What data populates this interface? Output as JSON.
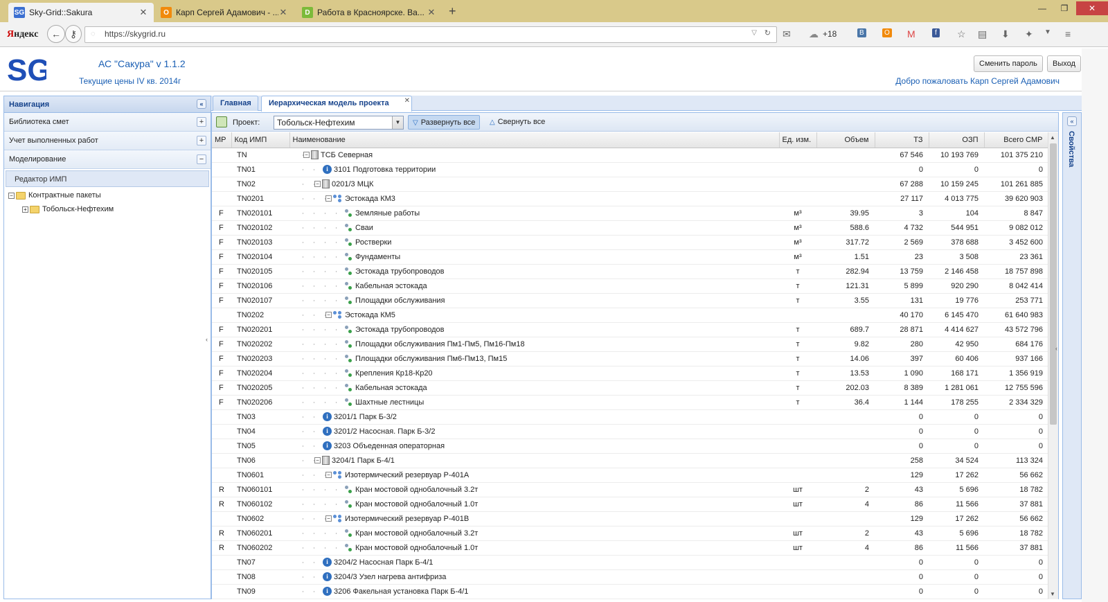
{
  "browser": {
    "tabs": [
      {
        "title": "Sky-Grid::Sakura",
        "favicon": "SG",
        "color": "#3b6fd1"
      },
      {
        "title": "Карп Сергей Адамович - ...",
        "favicon": "O",
        "color": "#f18a0c"
      },
      {
        "title": "Работа в Красноярске. Ва...",
        "favicon": "D",
        "color": "#7cba3a"
      }
    ],
    "logo_left": "Я",
    "logo_right": "ндекс",
    "url": "https://skygrid.ru",
    "weather": "+18"
  },
  "app": {
    "logo": "SG",
    "title": "АС \"Сакура\" v 1.1.2",
    "prices": "Текущие цены IV кв. 2014г",
    "change_password": "Сменить пароль",
    "logout": "Выход",
    "welcome": "Добро пожаловать Карп Сергей Адамович"
  },
  "nav": {
    "title": "Навигация",
    "items": [
      {
        "label": "Библиотека смет",
        "sign": "+"
      },
      {
        "label": "Учет выполненных работ",
        "sign": "+"
      },
      {
        "label": "Моделирование",
        "sign": "−"
      }
    ],
    "editor": "Редактор ИМП",
    "tree": {
      "root": "Контрактные пакеты",
      "child": "Тобольск-Нефтехим"
    }
  },
  "tabs": [
    {
      "label": "Главная"
    },
    {
      "label": "Иерархическая модель проекта"
    }
  ],
  "toolbar": {
    "project_label": "Проект:",
    "project": "Тобольск-Нефтехим",
    "expand": "Развернуть все",
    "collapse": "Свернуть все"
  },
  "properties": "Свойства",
  "grid": {
    "columns": [
      "МР",
      "Код ИМП",
      "Наименование",
      "Ед. изм.",
      "Объем",
      "ТЗ",
      "ОЗП",
      "Всего СМР"
    ],
    "rows": [
      {
        "mr": "",
        "code": "TN",
        "level": 0,
        "icon": "bldg",
        "toggle": "−",
        "name": "ТСБ Северная",
        "unit": "",
        "vol": "",
        "tz": "67 546",
        "ozp": "10 193 769",
        "smr": "101 375 210"
      },
      {
        "mr": "",
        "code": "TN01",
        "level": 1,
        "icon": "info",
        "toggle": "",
        "name": "3101 Подготовка территории",
        "unit": "",
        "vol": "",
        "tz": "0",
        "ozp": "0",
        "smr": "0"
      },
      {
        "mr": "",
        "code": "TN02",
        "level": 1,
        "icon": "bldg",
        "toggle": "−",
        "name": "0201/3 МЦК",
        "unit": "",
        "vol": "",
        "tz": "67 288",
        "ozp": "10 159 245",
        "smr": "101 261 885"
      },
      {
        "mr": "",
        "code": "TN0201",
        "level": 2,
        "icon": "tree3",
        "toggle": "−",
        "name": "Эстокада КМ3",
        "unit": "",
        "vol": "",
        "tz": "27 117",
        "ozp": "4 013 775",
        "smr": "39 620 903"
      },
      {
        "mr": "F",
        "code": "TN020101",
        "level": 3,
        "icon": "leaf",
        "toggle": "",
        "name": "Земляные работы",
        "unit": "м³",
        "vol": "39.95",
        "tz": "3",
        "ozp": "104",
        "smr": "8 847"
      },
      {
        "mr": "F",
        "code": "TN020102",
        "level": 3,
        "icon": "leaf",
        "toggle": "",
        "name": "Сваи",
        "unit": "м³",
        "vol": "588.6",
        "tz": "4 732",
        "ozp": "544 951",
        "smr": "9 082 012"
      },
      {
        "mr": "F",
        "code": "TN020103",
        "level": 3,
        "icon": "leaf",
        "toggle": "",
        "name": "Ростверки",
        "unit": "м³",
        "vol": "317.72",
        "tz": "2 569",
        "ozp": "378 688",
        "smr": "3 452 600"
      },
      {
        "mr": "F",
        "code": "TN020104",
        "level": 3,
        "icon": "leaf",
        "toggle": "",
        "name": "Фундаменты",
        "unit": "м³",
        "vol": "1.51",
        "tz": "23",
        "ozp": "3 508",
        "smr": "23 361"
      },
      {
        "mr": "F",
        "code": "TN020105",
        "level": 3,
        "icon": "leaf",
        "toggle": "",
        "name": "Эстокада трубопроводов",
        "unit": "т",
        "vol": "282.94",
        "tz": "13 759",
        "ozp": "2 146 458",
        "smr": "18 757 898"
      },
      {
        "mr": "F",
        "code": "TN020106",
        "level": 3,
        "icon": "leaf",
        "toggle": "",
        "name": "Кабельная эстокада",
        "unit": "т",
        "vol": "121.31",
        "tz": "5 899",
        "ozp": "920 290",
        "smr": "8 042 414"
      },
      {
        "mr": "F",
        "code": "TN020107",
        "level": 3,
        "icon": "leaf",
        "toggle": "",
        "name": "Площадки обслуживания",
        "unit": "т",
        "vol": "3.55",
        "tz": "131",
        "ozp": "19 776",
        "smr": "253 771"
      },
      {
        "mr": "",
        "code": "TN0202",
        "level": 2,
        "icon": "tree3",
        "toggle": "−",
        "name": "Эстокада КМ5",
        "unit": "",
        "vol": "",
        "tz": "40 170",
        "ozp": "6 145 470",
        "smr": "61 640 983"
      },
      {
        "mr": "F",
        "code": "TN020201",
        "level": 3,
        "icon": "leaf",
        "toggle": "",
        "name": "Эстокада трубопроводов",
        "unit": "т",
        "vol": "689.7",
        "tz": "28 871",
        "ozp": "4 414 627",
        "smr": "43 572 796"
      },
      {
        "mr": "F",
        "code": "TN020202",
        "level": 3,
        "icon": "leaf",
        "toggle": "",
        "name": "Площадки обслуживания Пм1-Пм5, Пм16-Пм18",
        "unit": "т",
        "vol": "9.82",
        "tz": "280",
        "ozp": "42 950",
        "smr": "684 176"
      },
      {
        "mr": "F",
        "code": "TN020203",
        "level": 3,
        "icon": "leaf",
        "toggle": "",
        "name": "Площадки обслуживания Пм6-Пм13, Пм15",
        "unit": "т",
        "vol": "14.06",
        "tz": "397",
        "ozp": "60 406",
        "smr": "937 166"
      },
      {
        "mr": "F",
        "code": "TN020204",
        "level": 3,
        "icon": "leaf",
        "toggle": "",
        "name": "Крепления Кр18-Кр20",
        "unit": "т",
        "vol": "13.53",
        "tz": "1 090",
        "ozp": "168 171",
        "smr": "1 356 919"
      },
      {
        "mr": "F",
        "code": "TN020205",
        "level": 3,
        "icon": "leaf",
        "toggle": "",
        "name": "Кабельная эстокада",
        "unit": "т",
        "vol": "202.03",
        "tz": "8 389",
        "ozp": "1 281 061",
        "smr": "12 755 596"
      },
      {
        "mr": "F",
        "code": "TN020206",
        "level": 3,
        "icon": "leaf",
        "toggle": "",
        "name": "Шахтные лестницы",
        "unit": "т",
        "vol": "36.4",
        "tz": "1 144",
        "ozp": "178 255",
        "smr": "2 334 329"
      },
      {
        "mr": "",
        "code": "TN03",
        "level": 1,
        "icon": "info",
        "toggle": "",
        "name": "3201/1 Парк Б-3/2",
        "unit": "",
        "vol": "",
        "tz": "0",
        "ozp": "0",
        "smr": "0"
      },
      {
        "mr": "",
        "code": "TN04",
        "level": 1,
        "icon": "info",
        "toggle": "",
        "name": "3201/2 Насосная. Парк Б-3/2",
        "unit": "",
        "vol": "",
        "tz": "0",
        "ozp": "0",
        "smr": "0"
      },
      {
        "mr": "",
        "code": "TN05",
        "level": 1,
        "icon": "info",
        "toggle": "",
        "name": "3203 Объеденная операторная",
        "unit": "",
        "vol": "",
        "tz": "0",
        "ozp": "0",
        "smr": "0"
      },
      {
        "mr": "",
        "code": "TN06",
        "level": 1,
        "icon": "bldg",
        "toggle": "−",
        "name": "3204/1 Парк Б-4/1",
        "unit": "",
        "vol": "",
        "tz": "258",
        "ozp": "34 524",
        "smr": "113 324"
      },
      {
        "mr": "",
        "code": "TN0601",
        "level": 2,
        "icon": "tree3",
        "toggle": "−",
        "name": "Изотермический резервуар Р-401А",
        "unit": "",
        "vol": "",
        "tz": "129",
        "ozp": "17 262",
        "smr": "56 662"
      },
      {
        "mr": "R",
        "code": "TN060101",
        "level": 3,
        "icon": "leaf",
        "toggle": "",
        "name": "Кран мостовой однобалочный 3.2т",
        "unit": "шт",
        "vol": "2",
        "tz": "43",
        "ozp": "5 696",
        "smr": "18 782"
      },
      {
        "mr": "R",
        "code": "TN060102",
        "level": 3,
        "icon": "leaf",
        "toggle": "",
        "name": "Кран мостовой однобалочный 1.0т",
        "unit": "шт",
        "vol": "4",
        "tz": "86",
        "ozp": "11 566",
        "smr": "37 881"
      },
      {
        "mr": "",
        "code": "TN0602",
        "level": 2,
        "icon": "tree3",
        "toggle": "−",
        "name": "Изотермический резервуар Р-401В",
        "unit": "",
        "vol": "",
        "tz": "129",
        "ozp": "17 262",
        "smr": "56 662"
      },
      {
        "mr": "R",
        "code": "TN060201",
        "level": 3,
        "icon": "leaf",
        "toggle": "",
        "name": "Кран мостовой однобалочный 3.2т",
        "unit": "шт",
        "vol": "2",
        "tz": "43",
        "ozp": "5 696",
        "smr": "18 782"
      },
      {
        "mr": "R",
        "code": "TN060202",
        "level": 3,
        "icon": "leaf",
        "toggle": "",
        "name": "Кран мостовой однобалочный 1.0т",
        "unit": "шт",
        "vol": "4",
        "tz": "86",
        "ozp": "11 566",
        "smr": "37 881"
      },
      {
        "mr": "",
        "code": "TN07",
        "level": 1,
        "icon": "info",
        "toggle": "",
        "name": "3204/2 Насосная Парк Б-4/1",
        "unit": "",
        "vol": "",
        "tz": "0",
        "ozp": "0",
        "smr": "0"
      },
      {
        "mr": "",
        "code": "TN08",
        "level": 1,
        "icon": "info",
        "toggle": "",
        "name": "3204/3 Узел нагрева антифриза",
        "unit": "",
        "vol": "",
        "tz": "0",
        "ozp": "0",
        "smr": "0"
      },
      {
        "mr": "",
        "code": "TN09",
        "level": 1,
        "icon": "info",
        "toggle": "",
        "name": "3206 Факельная установка Парк Б-4/1",
        "unit": "",
        "vol": "",
        "tz": "0",
        "ozp": "0",
        "smr": "0"
      }
    ]
  },
  "colors": {
    "accent": "#15428b",
    "link": "#1a5fb4",
    "panel_border": "#99bbe8"
  }
}
